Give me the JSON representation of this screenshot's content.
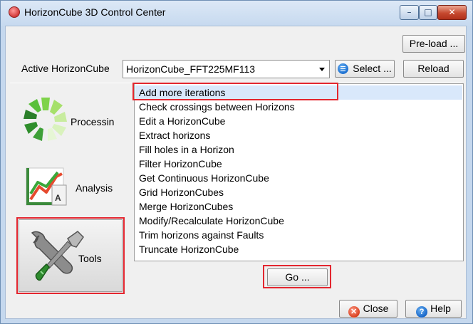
{
  "window": {
    "title": "HorizonCube 3D Control Center",
    "controls": {
      "minimize": "–",
      "maximize": "□",
      "close": "✕"
    }
  },
  "toolbar": {
    "preload_label": "Pre-load ...",
    "active_label": "Active HorizonCube",
    "active_value": "HorizonCube_FFT225MF113",
    "select_label": "Select ...",
    "reload_label": "Reload"
  },
  "categories": [
    {
      "label": "Processin",
      "icon": "processing-wheel-icon"
    },
    {
      "label": "Analysis",
      "icon": "analysis-chart-icon"
    },
    {
      "label": "Tools",
      "icon": "tools-wrench-screwdriver-icon"
    }
  ],
  "tools_list": {
    "selected_index": 0,
    "items": [
      "Add more iterations",
      "Check crossings between Horizons",
      "Edit a HorizonCube",
      "Extract horizons",
      "Fill holes in a Horizon",
      "Filter HorizonCube",
      "Get Continuous HorizonCube",
      "Grid HorizonCubes",
      "Merge HorizonCubes",
      "Modify/Recalculate HorizonCube",
      "Trim horizons against Faults",
      "Truncate HorizonCube"
    ]
  },
  "actions": {
    "go_label": "Go ...",
    "close_label": "Close",
    "help_label": "Help"
  },
  "colors": {
    "highlight": "#e3262f",
    "selection": "#d9e8fb",
    "title_bar": "#c6d9ef"
  }
}
